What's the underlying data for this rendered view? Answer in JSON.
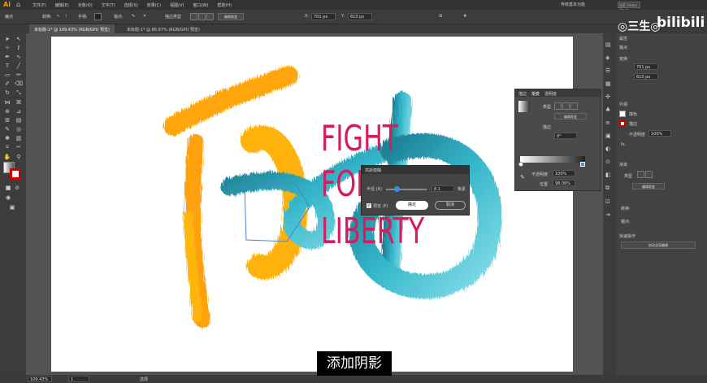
{
  "menubar": {
    "logo": "Ai",
    "items": [
      "文件(F)",
      "编辑(E)",
      "对象(O)",
      "文字(T)",
      "选择(S)",
      "效果(C)",
      "视图(V)",
      "窗口(W)",
      "帮助(H)"
    ],
    "workspace": "传统基本功能",
    "search": "搜索 Adobe Stock"
  },
  "control": {
    "label": "编点",
    "convert": "转换:",
    "handle": "手柄:",
    "anchor": "锚点:",
    "style_label": "描边类型",
    "edit_gradient": "编辑渐变",
    "x_label": "X:",
    "x": "701 px",
    "y_label": "Y:",
    "y": "610 px"
  },
  "tabs": [
    {
      "label": "未标题-1* @ 109.43% (RGB/GPU 预览)"
    },
    {
      "label": "未标题-1* @ 86.67% (RGB/GPU 预览)"
    }
  ],
  "art": {
    "fight": "FIGHT",
    "for": "FOR",
    "liberty": "LIBERTY"
  },
  "properties": {
    "title": "属性",
    "section_anchor": "锚点",
    "section_transform": "变换",
    "x": "701 px",
    "y": "610 px",
    "section_appearance": "外观",
    "fill": "填色",
    "stroke": "描边",
    "opacity_label": "不透明度",
    "opacity": "100%",
    "fx": "fx.",
    "section_gradient": "渐变",
    "type_label": "类型",
    "edit_gradient": "编辑渐变",
    "convert": "转换:",
    "anchor": "锚点:",
    "quick_actions": "快速操作",
    "quick_button": "启动全局编辑"
  },
  "gradient": {
    "tabs": [
      "描边",
      "渐变",
      "透明度"
    ],
    "type_label": "类型",
    "edit_gradient": "编辑渐变",
    "stroke_label": "描边",
    "angle": "0°",
    "opacity_label": "不透明度",
    "opacity": "100%",
    "position_label": "位置",
    "position": "98.08%"
  },
  "dialog": {
    "title": "高斯模糊",
    "radius_label": "半径 (R)",
    "radius_value": "8.1",
    "unit": "像素",
    "preview": "预览 (P)",
    "ok": "确定",
    "cancel": "取消",
    "slider_fraction": 0.25
  },
  "status": {
    "zoom": "109.43%",
    "page": "1",
    "tool": "选择"
  },
  "caption": "添加阴影",
  "watermark": {
    "left": "◎三生◎",
    "right": "bilibili"
  },
  "colors": {
    "orange": "#ff9d00",
    "teal": "#1a9cb0",
    "pink": "#d81b60"
  }
}
